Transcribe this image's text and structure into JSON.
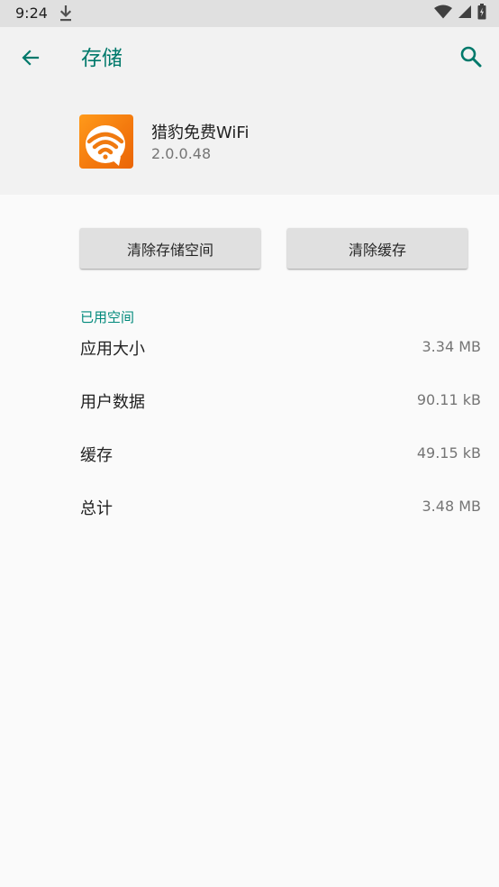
{
  "status_bar": {
    "time": "9:24",
    "icons": [
      "download-icon",
      "wifi-icon",
      "signal-icon",
      "battery-icon"
    ]
  },
  "app_bar": {
    "title": "存储",
    "back_icon": "arrow-back-icon",
    "search_icon": "search-icon"
  },
  "app_info": {
    "name": "猎豹免费WiFi",
    "version": "2.0.0.48",
    "icon": "wifi-app-icon"
  },
  "buttons": {
    "clear_storage": "清除存储空间",
    "clear_cache": "清除缓存"
  },
  "storage": {
    "section_title": "已用空间",
    "rows": [
      {
        "label": "应用大小",
        "value": "3.34 MB"
      },
      {
        "label": "用户数据",
        "value": "90.11 kB"
      },
      {
        "label": "缓存",
        "value": "49.15 kB"
      },
      {
        "label": "总计",
        "value": "3.48 MB"
      }
    ]
  },
  "colors": {
    "accent": "#00796b",
    "section_accent": "#00897b",
    "status_bar_bg": "#e0e0e0",
    "header_bg": "#f2f2f2",
    "page_bg": "#fafafa",
    "button_bg": "#e0e0e0",
    "app_icon_orange": "#f47a0e"
  }
}
